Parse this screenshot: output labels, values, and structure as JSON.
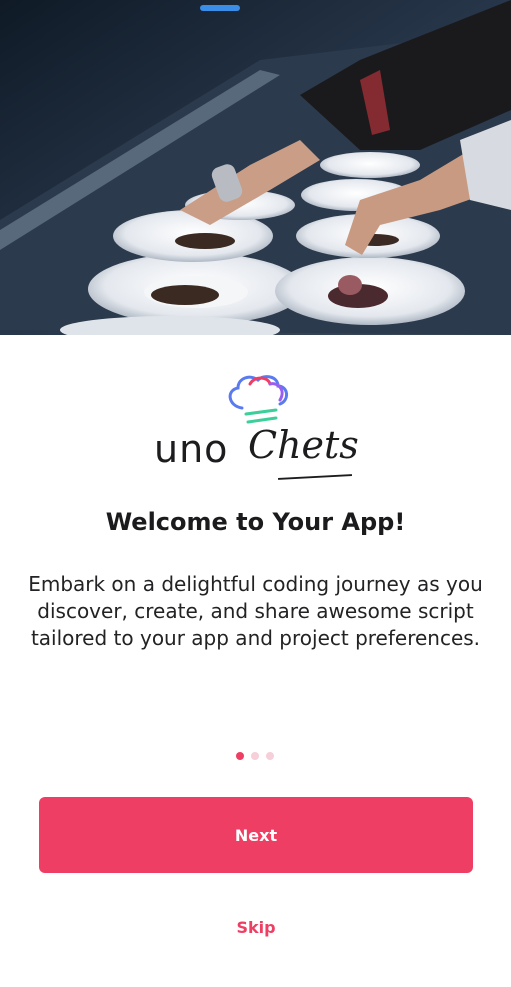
{
  "hero": {
    "image": "chef-plating-dishes"
  },
  "logo": {
    "brand": "unoChets",
    "part_plain": "uno",
    "part_script": "Chets",
    "icon": "chef-hat-icon"
  },
  "welcome": {
    "title": "Welcome to Your App!",
    "description": "Embark on a delightful coding journey as you discover, create, and share awesome script tailored to your app and project preferences."
  },
  "pager": {
    "total": 3,
    "current": 1
  },
  "actions": {
    "next_label": "Next",
    "skip_label": "Skip"
  },
  "colors": {
    "accent": "#ef3e63",
    "accent_light": "#f6cfd9",
    "text": "#1b1b1d"
  }
}
